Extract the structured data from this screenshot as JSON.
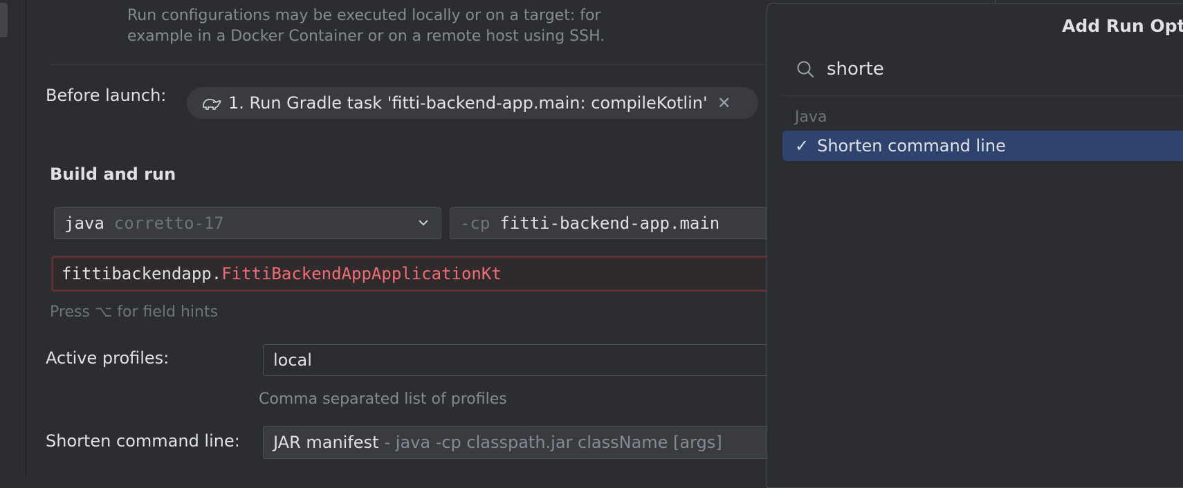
{
  "description": {
    "line1": "Run configurations may be executed locally or on a target: for",
    "line2": "example in a Docker Container or on a remote host using SSH."
  },
  "before_launch": {
    "label": "Before launch:",
    "task": "1. Run Gradle task 'fitti-backend-app.main: compileKotlin'",
    "icon": "gradle-elephant-icon"
  },
  "build_and_run": {
    "title": "Build and run",
    "jre_name": "java",
    "jre_version": "corretto-17",
    "classpath_flag": "-cp",
    "classpath_module": "fitti-backend-app.main",
    "main_class_package": "fittibackendapp.",
    "main_class_name": "FittiBackendAppApplicationKt",
    "field_hint": "Press ⌥ for field hints"
  },
  "active_profiles": {
    "label": "Active profiles:",
    "value": "local",
    "hint": "Comma separated list of profiles"
  },
  "shorten_command_line": {
    "label": "Shorten command line:",
    "value": "JAR manifest",
    "detail": "- java -cp classpath.jar className [args]"
  },
  "popup": {
    "title": "Add Run Optic",
    "search_value": "shorte",
    "group": "Java",
    "option_label": "Shorten command line",
    "option_checked": true
  },
  "colors": {
    "background": "#2b2d30",
    "selection": "#2e436e",
    "error_text": "#f26c77",
    "error_border": "#5b3136"
  }
}
